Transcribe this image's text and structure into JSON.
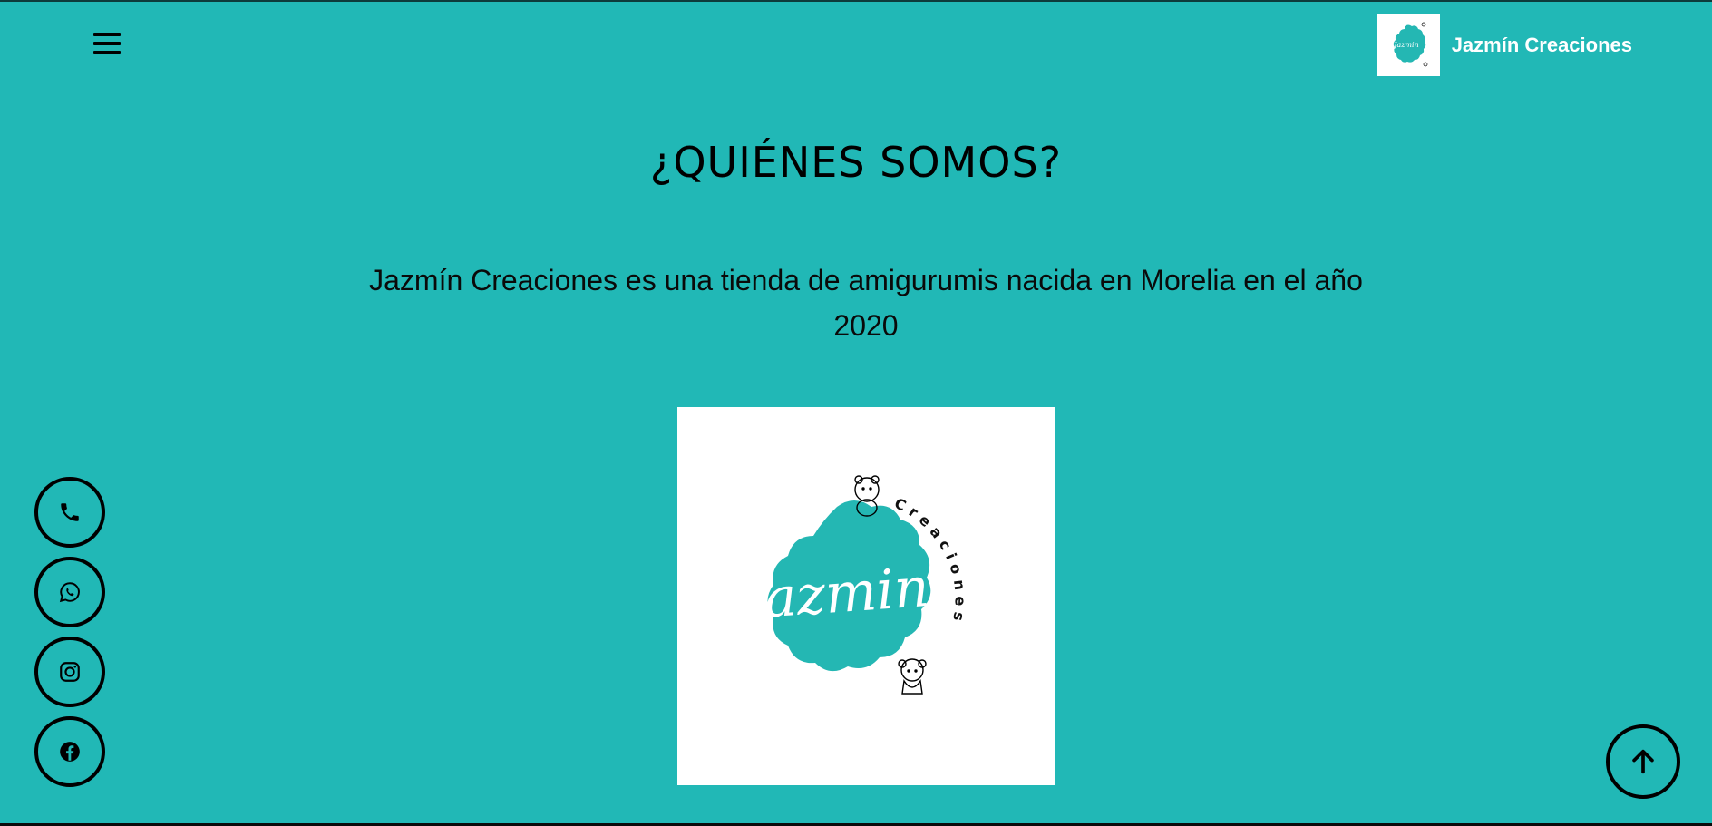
{
  "header": {
    "brand_name": "Jazmín Creaciones",
    "menu_icon": "hamburger-menu-icon"
  },
  "about": {
    "title": "¿QUIÉNES SOMOS?",
    "description": "Jazmín Creaciones es una tienda de amigurumis nacida en Morelia en el año 2020"
  },
  "logo": {
    "script_text": "Jazmin",
    "arc_text": "Creaciones"
  },
  "social": [
    {
      "icon": "phone-icon"
    },
    {
      "icon": "whatsapp-icon"
    },
    {
      "icon": "instagram-icon"
    },
    {
      "icon": "facebook-icon"
    }
  ],
  "scroll_top": {
    "icon": "arrow-up-icon"
  },
  "colors": {
    "background": "#21b8b6",
    "logo_teal": "#24b7b3",
    "text": "#000000",
    "brand_text": "#ffffff"
  }
}
